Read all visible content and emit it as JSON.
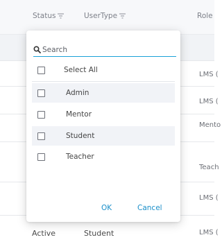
{
  "table": {
    "columns": [
      {
        "label": "Status",
        "icon": "filter-icon"
      },
      {
        "label": "UserType",
        "icon": "filter-icon"
      },
      {
        "label": "Role"
      }
    ],
    "role_cells": [
      "LMS (",
      "LMS (",
      "Mento",
      "Teach",
      "LMS (",
      "LMS ("
    ],
    "last_row": {
      "status": "Active",
      "user_type": "Student"
    }
  },
  "filter_dropdown": {
    "search": {
      "placeholder": "Search",
      "icon": "search-icon"
    },
    "select_all_label": "Select All",
    "options": [
      {
        "label": "Admin",
        "checked": false,
        "highlighted": true
      },
      {
        "label": "Mentor",
        "checked": false,
        "highlighted": false
      },
      {
        "label": "Student",
        "checked": false,
        "highlighted": true
      },
      {
        "label": "Teacher",
        "checked": false,
        "highlighted": false
      }
    ],
    "ok_label": "OK",
    "cancel_label": "Cancel"
  },
  "colors": {
    "accent": "#1aa0d8",
    "button_text": "#1a8fc9",
    "highlight_row": "#f1f3f7"
  }
}
